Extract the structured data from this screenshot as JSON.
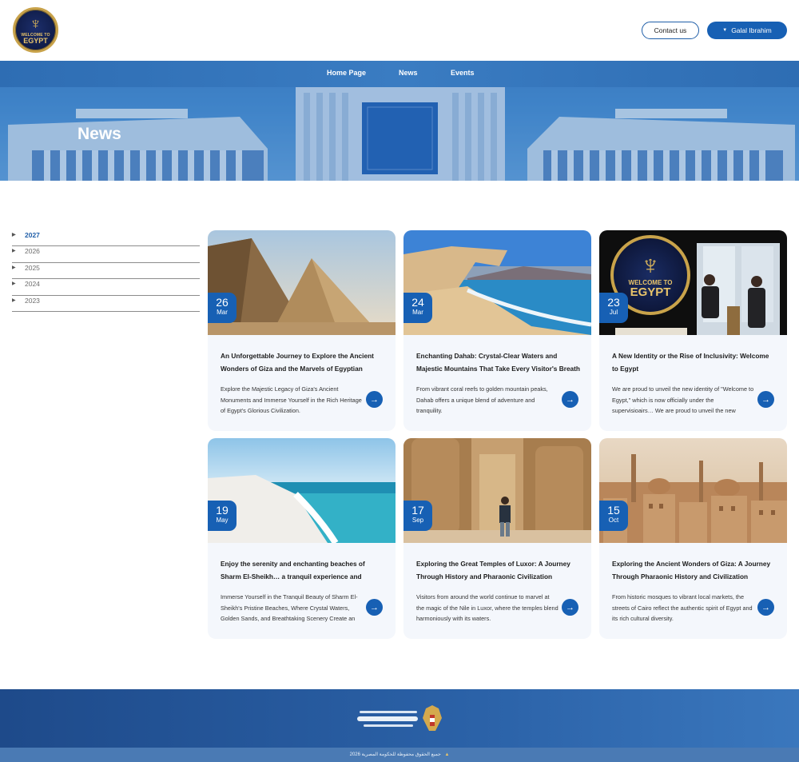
{
  "header": {
    "logo": {
      "line1": "WELCOME TO",
      "line2": "EGYPT",
      "icon": "falcon-emblem-icon"
    },
    "contact_label": "Contact us",
    "user_label": "Galal Ibrahim",
    "user_caret_icon": "caret-down-icon"
  },
  "nav": {
    "items": [
      {
        "label": "Home Page"
      },
      {
        "label": "News"
      },
      {
        "label": "Events"
      }
    ]
  },
  "hero": {
    "title": "News"
  },
  "sidebar": {
    "years": [
      {
        "label": "2027",
        "active": true
      },
      {
        "label": "2026",
        "active": false
      },
      {
        "label": "2025",
        "active": false
      },
      {
        "label": "2024",
        "active": false
      },
      {
        "label": "2023",
        "active": false
      }
    ]
  },
  "cards": [
    {
      "day": "26",
      "month": "Mar",
      "title": "An Unforgettable Journey to Explore the Ancient Wonders of Giza and the Marvels of Egyptian Civilizati…",
      "desc": "Explore the Majestic Legacy of Giza's Ancient Monuments and Immerse Yourself in the Rich Heritage of Egypt's Glorious Civilization.",
      "image": "pyramids"
    },
    {
      "day": "24",
      "month": "Mar",
      "title": "Enchanting Dahab: Crystal-Clear Waters and Majestic Mountains That Take Every Visitor's Breath Away",
      "desc": "From vibrant coral reefs to golden mountain peaks, Dahab offers a unique blend of adventure and tranquility.",
      "image": "dahab-coast"
    },
    {
      "day": "23",
      "month": "Jul",
      "title": "A New Identity or the Rise of Inclusivity: Welcome to Egypt",
      "desc": "We are proud to unveil the new identity of \"Welcome to Egypt,\" which is now officially under the supervisioairs… We are proud to unveil the new identity of the initiativ…",
      "image": "welcome-to-egypt-event",
      "logo_line1": "WELCOME TO",
      "logo_line2": "EGYPT"
    },
    {
      "day": "19",
      "month": "May",
      "title": "Enjoy the serenity and enchanting beaches of Sharm El-Sheikh… a tranquil experience and natural beauty that…",
      "desc": "Immerse Yourself in the Tranquil Beauty of Sharm El-Sheikh's Pristine Beaches, Where Crystal Waters, Golden Sands, and Breathtaking Scenery Create an Un…",
      "image": "sharm-beach"
    },
    {
      "day": "17",
      "month": "Sep",
      "title": "Exploring the Great Temples of Luxor: A Journey Through History and Pharaonic Civilization",
      "desc": "Visitors from around the world continue to marvel at the magic of the Nile in Luxor, where the temples blend harmoniously with its waters.",
      "image": "luxor-temple"
    },
    {
      "day": "15",
      "month": "Oct",
      "title": "Exploring the Ancient Wonders of Giza: A Journey Through Pharaonic History and Civilization",
      "desc": "From historic mosques to vibrant local markets, the streets of Cairo reflect the authentic spirit of Egypt and its rich cultural diversity.",
      "image": "cairo-skyline"
    }
  ],
  "footer": {
    "logo_icon": "ministry-eagle-icon",
    "copyright": "جميع الحقوق محفوظة للحكومة المصرية 2026"
  },
  "colors": {
    "primary": "#1760b4",
    "nav": "#2e6db3",
    "card_bg": "#f4f7fc",
    "footer": "#1e4a8a"
  }
}
